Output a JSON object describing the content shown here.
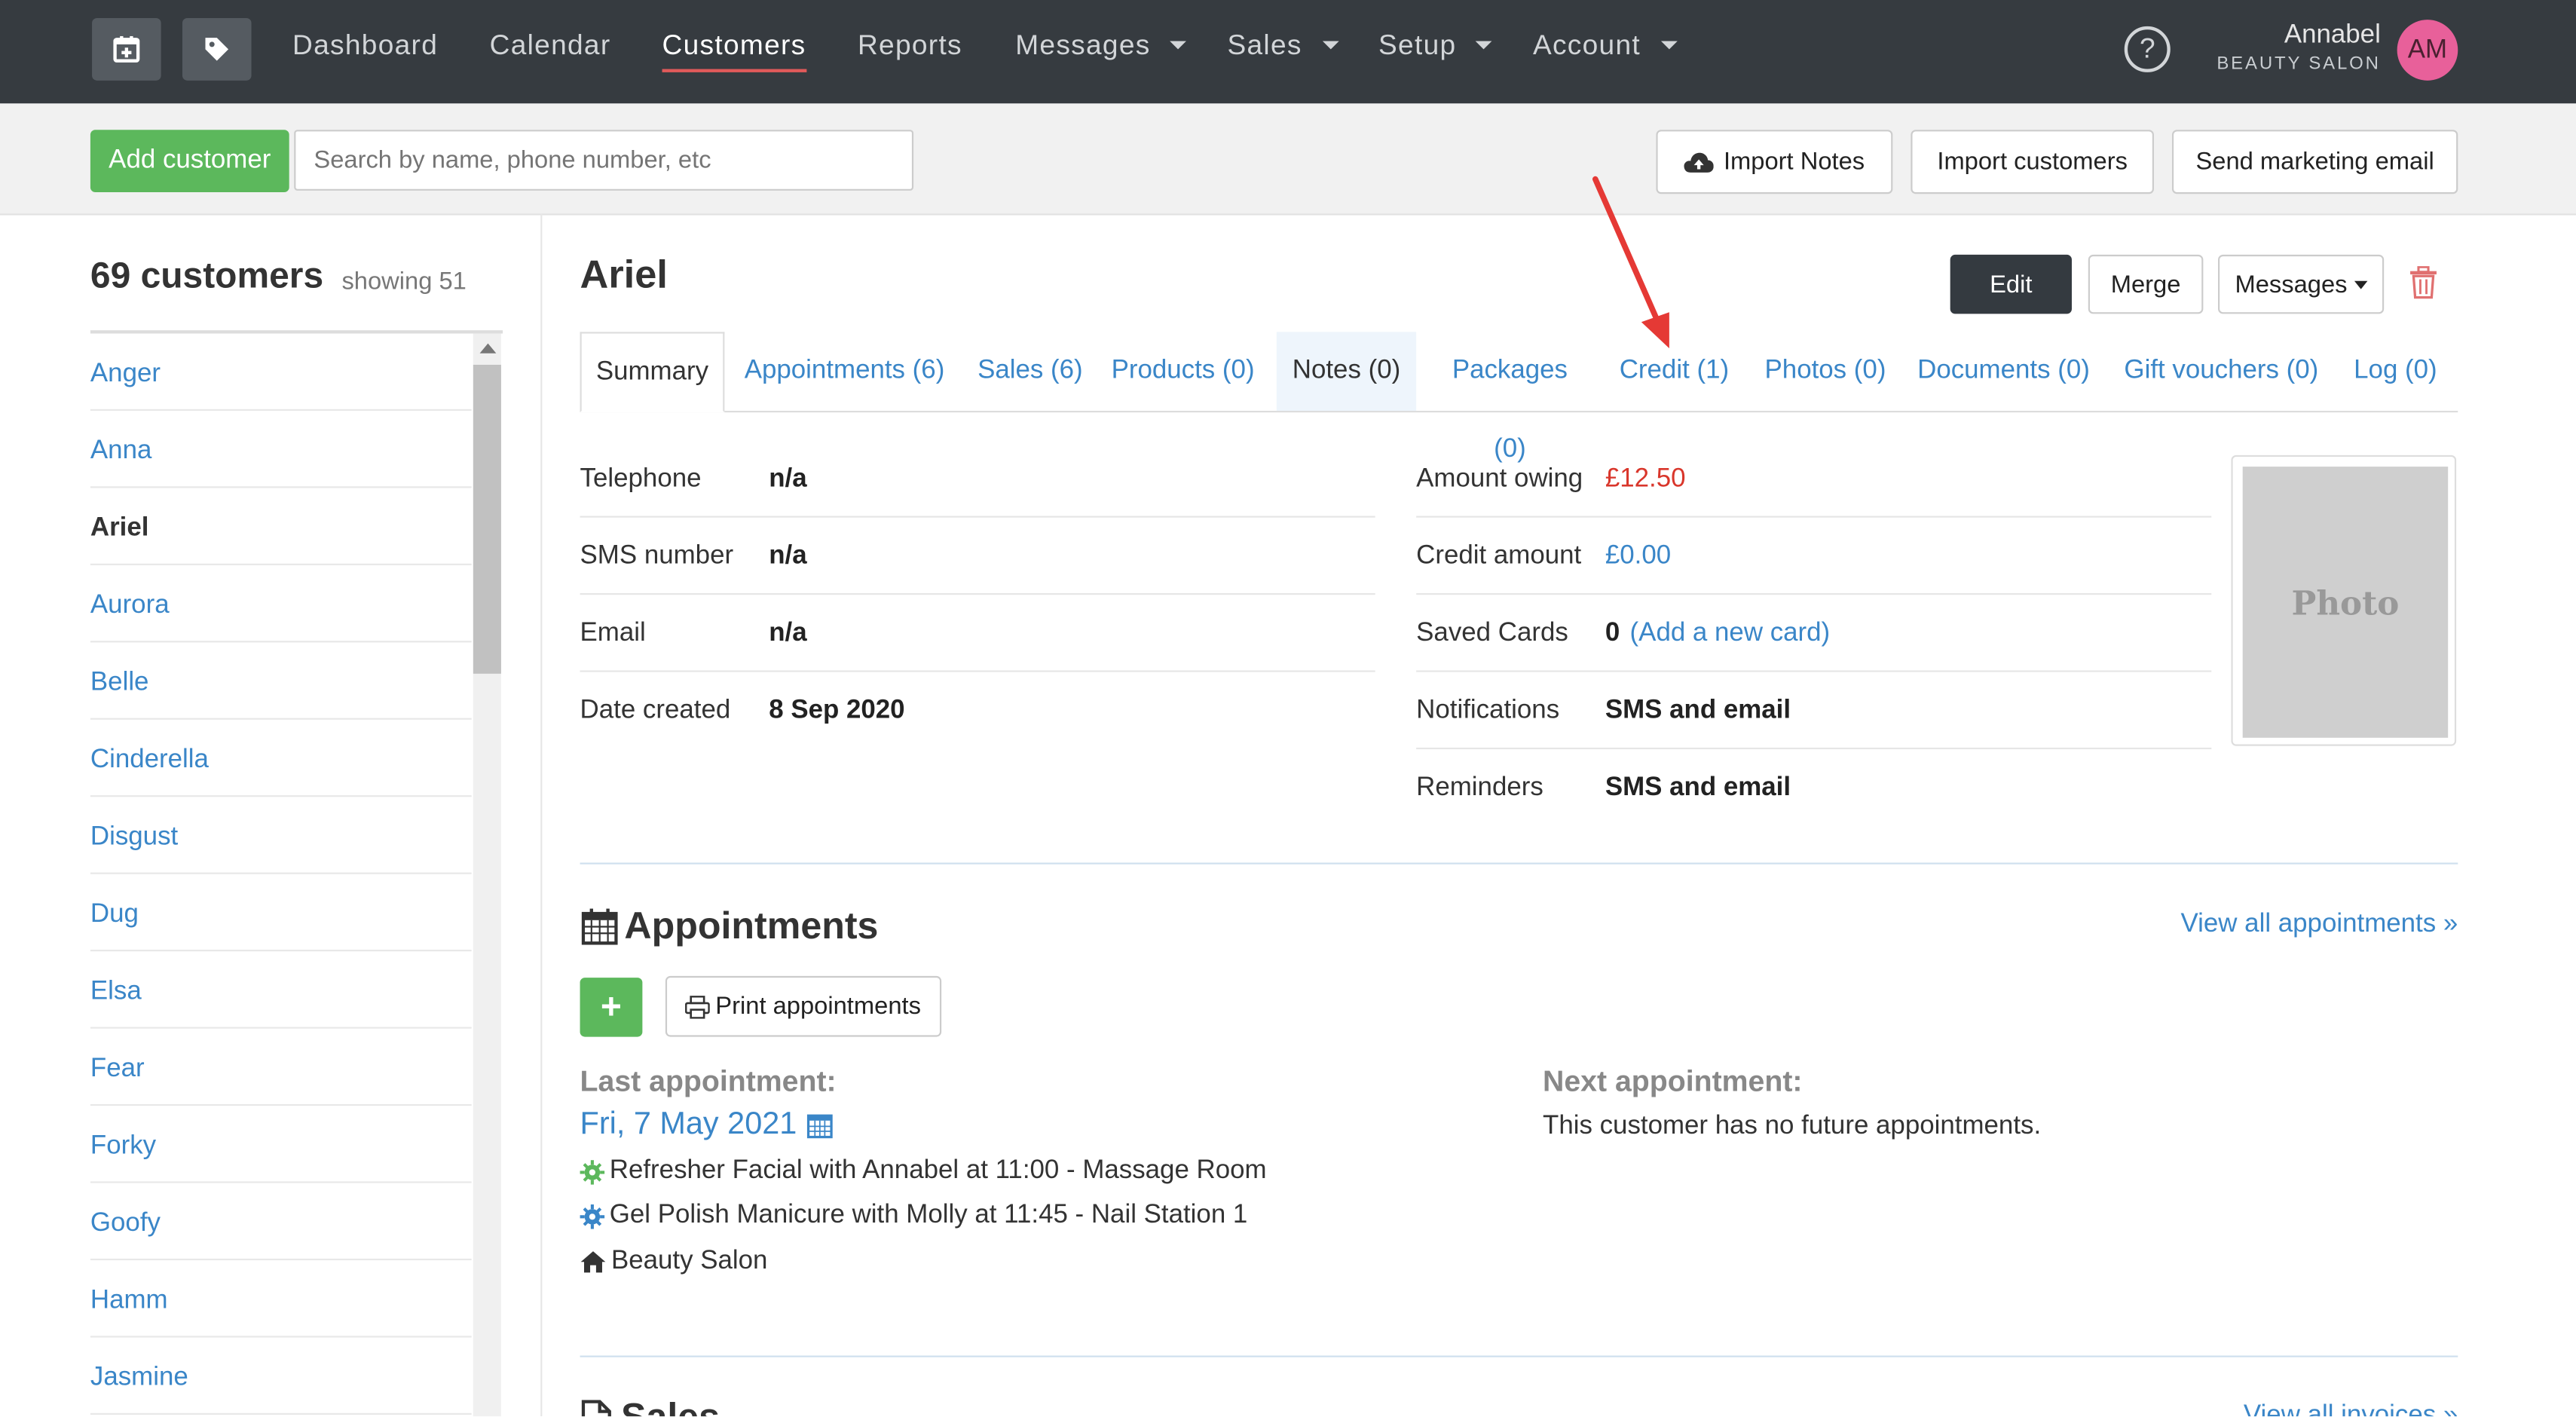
{
  "nav": {
    "items": [
      {
        "label": "Dashboard"
      },
      {
        "label": "Calendar"
      },
      {
        "label": "Customers"
      },
      {
        "label": "Reports"
      },
      {
        "label": "Messages"
      },
      {
        "label": "Sales"
      },
      {
        "label": "Setup"
      },
      {
        "label": "Account"
      }
    ],
    "user_name": "Annabel",
    "salon_name": "BEAUTY SALON",
    "avatar_initials": "AM",
    "help_glyph": "?"
  },
  "toolbar": {
    "add_customer": "Add customer",
    "search_placeholder": "Search by name, phone number, etc",
    "import_notes": "Import Notes",
    "import_customers": "Import customers",
    "send_marketing": "Send marketing email"
  },
  "sidebar": {
    "count": "69 customers",
    "showing": "showing 51",
    "customers": [
      "Anger",
      "Anna",
      "Ariel",
      "Aurora",
      "Belle",
      "Cinderella",
      "Disgust",
      "Dug",
      "Elsa",
      "Fear",
      "Forky",
      "Goofy",
      "Hamm",
      "Jasmine"
    ],
    "selected": "Ariel"
  },
  "customer": {
    "name": "Ariel",
    "edit": "Edit",
    "merge": "Merge",
    "messages": "Messages"
  },
  "tabs": [
    {
      "label": "Summary"
    },
    {
      "label": "Appointments (6)"
    },
    {
      "label": "Sales (6)"
    },
    {
      "label": "Products (0)"
    },
    {
      "label": "Notes (0)"
    },
    {
      "label": "Packages (0)"
    },
    {
      "label": "Credit (1)"
    },
    {
      "label": "Photos (0)"
    },
    {
      "label": "Documents (0)"
    },
    {
      "label": "Gift vouchers (0)"
    },
    {
      "label": "Log (0)"
    }
  ],
  "details_left": [
    {
      "label": "Telephone",
      "value": "n/a"
    },
    {
      "label": "SMS number",
      "value": "n/a"
    },
    {
      "label": "Email",
      "value": "n/a"
    },
    {
      "label": "Date created",
      "value": "8 Sep 2020"
    }
  ],
  "details_right": {
    "amount_owing": {
      "label": "Amount owing",
      "value": "£12.50"
    },
    "credit": {
      "label": "Credit amount",
      "value": "£0.00"
    },
    "saved_cards": {
      "label": "Saved Cards",
      "value": "0",
      "link": "(Add a new card)"
    },
    "notifications": {
      "label": "Notifications",
      "value": "SMS and email"
    },
    "reminders": {
      "label": "Reminders",
      "value": "SMS and email"
    }
  },
  "photo_placeholder": "Photo",
  "appointments": {
    "title": "Appointments",
    "view_all": "View all appointments »",
    "print": "Print appointments",
    "add_glyph": "+",
    "last_label": "Last appointment:",
    "last_date": "Fri, 7 May 2021",
    "services": [
      "Refresher Facial with Annabel at 11:00 - Massage Room",
      "Gel Polish Manicure with Molly at 11:45 - Nail Station 1"
    ],
    "location": "Beauty Salon",
    "next_label": "Next appointment:",
    "next_text": "This customer has no future appointments."
  },
  "sales": {
    "title": "Sales",
    "view_all": "View all invoices »"
  },
  "colors": {
    "accent": "#3a86c8",
    "green": "#5cb85c",
    "owing": "#d9362b",
    "nav_bg": "#363b40",
    "annotation_arrow": "#e53935"
  }
}
